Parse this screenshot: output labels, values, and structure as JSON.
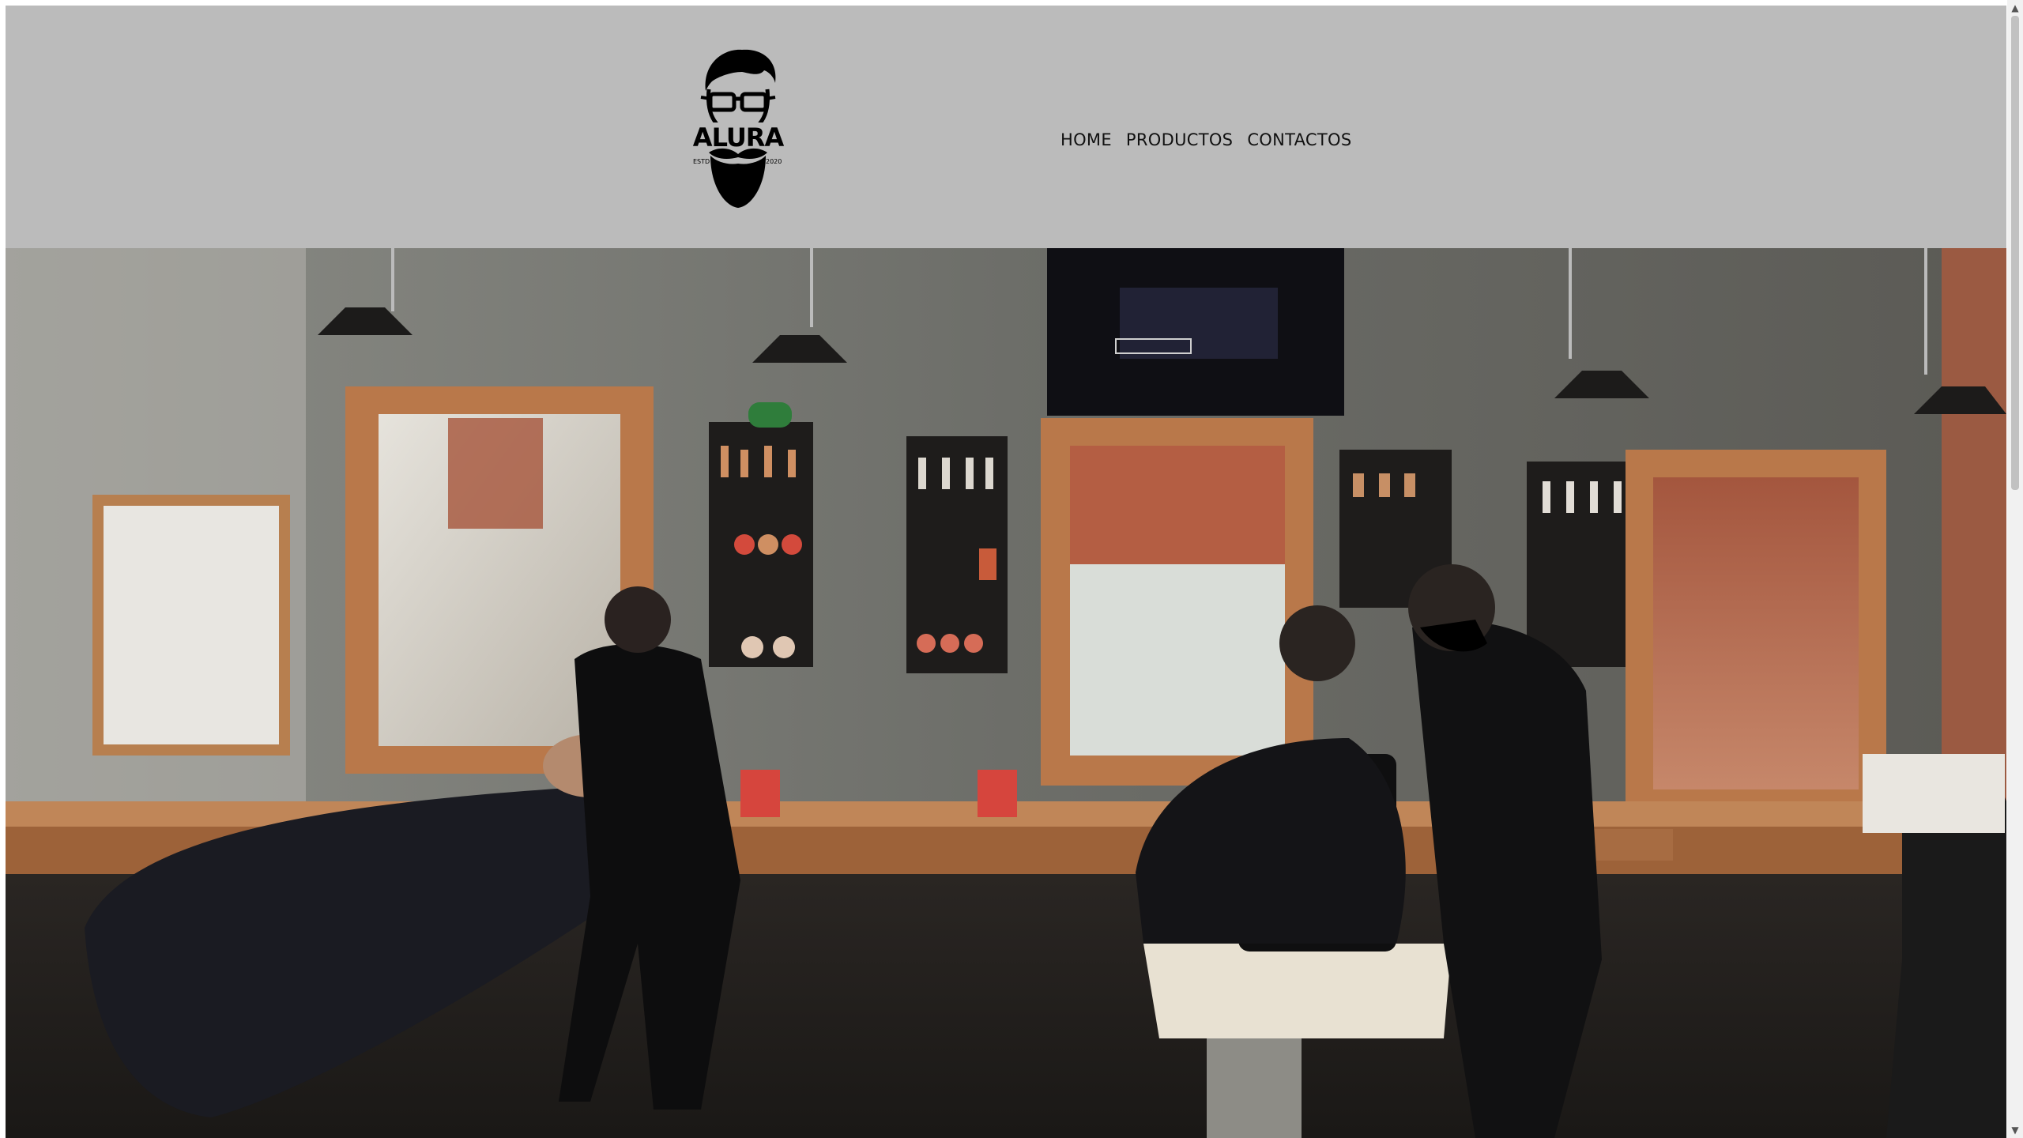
{
  "header": {
    "logo": {
      "icon": "bearded-man-glasses-logo-icon",
      "text": "ALURA",
      "est_label": "ESTD",
      "year": "2020"
    },
    "nav": {
      "items": [
        {
          "label": "HOME"
        },
        {
          "label": "PRODUCTOS"
        },
        {
          "label": "CONTACTOS"
        }
      ]
    }
  },
  "hero": {
    "image": "barbershop-interior-photo"
  },
  "colors": {
    "header_bg": "#bbbbbb",
    "nav_text": "#111111",
    "logo": "#000000"
  }
}
